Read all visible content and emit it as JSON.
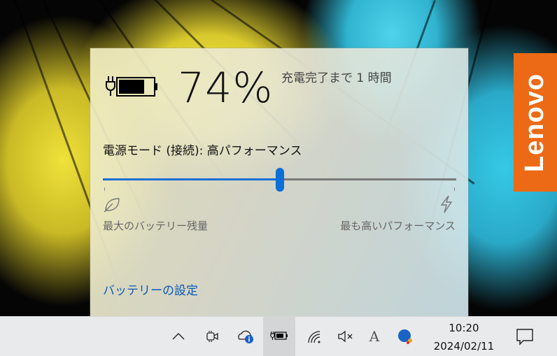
{
  "flyout": {
    "battery_percent": "74%",
    "time_remaining": "充電完了まで 1 時間",
    "power_mode_label": "電源モード (接続): 高パフォーマンス",
    "slider_level": 0.5,
    "left_label": "最大のバッテリー残量",
    "right_label": "最も高いパフォーマンス",
    "settings_link": "バッテリーの設定",
    "battery_charge_fraction": 0.74
  },
  "brand": {
    "logo_text": "Lenovo",
    "logo_color": "#ec6a16"
  },
  "taskbar": {
    "time": "10:20",
    "date": "2024/02/11",
    "ime_indicator": "A",
    "icons": [
      "chevron-up-icon",
      "meet-now-icon",
      "onedrive-icon",
      "battery-icon",
      "wifi-icon",
      "volume-muted-icon",
      "ime-icon",
      "app-icon",
      "notification-icon"
    ]
  },
  "colors": {
    "accent": "#0a6fd6",
    "link": "#0a59b8"
  }
}
